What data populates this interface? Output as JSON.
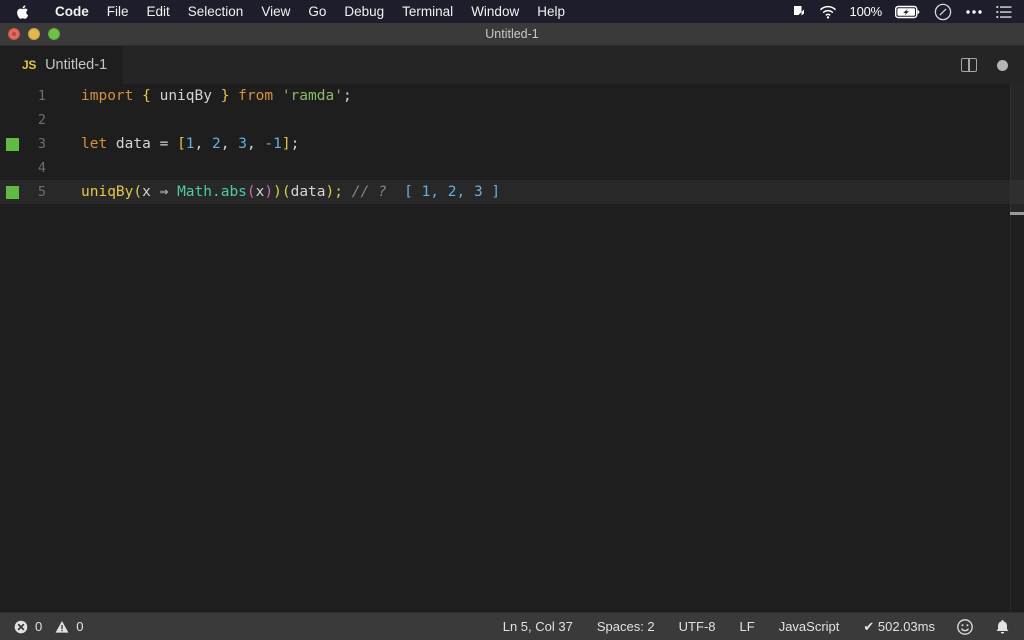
{
  "menubar": {
    "apple_icon": "apple-logo-icon",
    "items": [
      {
        "label": "Code",
        "bold": true
      },
      {
        "label": "File",
        "bold": false
      },
      {
        "label": "Edit",
        "bold": false
      },
      {
        "label": "Selection",
        "bold": false
      },
      {
        "label": "View",
        "bold": false
      },
      {
        "label": "Go",
        "bold": false
      },
      {
        "label": "Debug",
        "bold": false
      },
      {
        "label": "Terminal",
        "bold": false
      },
      {
        "label": "Window",
        "bold": false
      },
      {
        "label": "Help",
        "bold": false
      }
    ],
    "status_icons": [
      "dropbox-icon",
      "wifi-icon",
      "battery-icon",
      "siri-icon",
      "control-center-icon",
      "notification-center-icon"
    ],
    "battery_percent": "100%",
    "background_color": "#1d1d2b"
  },
  "window": {
    "title": "Untitled-1",
    "traffic_lights": [
      "close-button",
      "minimize-button",
      "zoom-button"
    ],
    "titlebar_color": "#3a3a3a"
  },
  "tabstrip": {
    "tab": {
      "file_type_badge": "JS",
      "label": "Untitled-1"
    },
    "actions": {
      "split_editor": "split-editor-icon",
      "unsaved_indicator": "unsaved-dot-icon"
    }
  },
  "editor": {
    "language": "JavaScript",
    "background_color": "#1e1e1e",
    "current_line": 5,
    "lines": [
      {
        "number": "1",
        "has_run_marker": false,
        "current": false,
        "tokens": [
          {
            "text": "import",
            "cls": "t-kw"
          },
          {
            "text": " ",
            "cls": "t-plain"
          },
          {
            "text": "{",
            "cls": "t-brace"
          },
          {
            "text": " uniqBy ",
            "cls": "t-plain"
          },
          {
            "text": "}",
            "cls": "t-brace"
          },
          {
            "text": " ",
            "cls": "t-plain"
          },
          {
            "text": "from",
            "cls": "t-kw"
          },
          {
            "text": " ",
            "cls": "t-plain"
          },
          {
            "text": "'ramda'",
            "cls": "t-string"
          },
          {
            "text": ";",
            "cls": "t-plain"
          }
        ]
      },
      {
        "number": "2",
        "has_run_marker": false,
        "current": false,
        "tokens": []
      },
      {
        "number": "3",
        "has_run_marker": true,
        "current": false,
        "tokens": [
          {
            "text": "let",
            "cls": "t-kw"
          },
          {
            "text": " data ",
            "cls": "t-plain"
          },
          {
            "text": "=",
            "cls": "t-plain"
          },
          {
            "text": " ",
            "cls": "t-plain"
          },
          {
            "text": "[",
            "cls": "t-brace"
          },
          {
            "text": "1",
            "cls": "t-num"
          },
          {
            "text": ", ",
            "cls": "t-plain"
          },
          {
            "text": "2",
            "cls": "t-num"
          },
          {
            "text": ", ",
            "cls": "t-plain"
          },
          {
            "text": "3",
            "cls": "t-num"
          },
          {
            "text": ", ",
            "cls": "t-plain"
          },
          {
            "text": "-1",
            "cls": "t-num"
          },
          {
            "text": "]",
            "cls": "t-brace"
          },
          {
            "text": ";",
            "cls": "t-plain"
          }
        ]
      },
      {
        "number": "4",
        "has_run_marker": false,
        "current": false,
        "tokens": []
      },
      {
        "number": "5",
        "has_run_marker": true,
        "current": true,
        "tokens": [
          {
            "text": "uniqBy",
            "cls": "t-fn"
          },
          {
            "text": "(",
            "cls": "t-paren-y"
          },
          {
            "text": "x",
            "cls": "t-plain"
          },
          {
            "text": " ⇒ ",
            "cls": "t-plain"
          },
          {
            "text": "Math",
            "cls": "t-class"
          },
          {
            "text": ".",
            "cls": "t-class"
          },
          {
            "text": "abs",
            "cls": "t-class"
          },
          {
            "text": "(",
            "cls": "t-paren-m"
          },
          {
            "text": "x",
            "cls": "t-plain"
          },
          {
            "text": ")",
            "cls": "t-paren-m"
          },
          {
            "text": ")",
            "cls": "t-paren-y"
          },
          {
            "text": "(",
            "cls": "t-paren-y"
          },
          {
            "text": "data",
            "cls": "t-plain"
          },
          {
            "text": ")",
            "cls": "t-paren-y"
          },
          {
            "text": ";",
            "cls": "t-brace"
          },
          {
            "text": " ",
            "cls": "t-plain"
          },
          {
            "text": "// ?",
            "cls": "t-comment"
          },
          {
            "text": "  ",
            "cls": "t-plain"
          },
          {
            "text": "[ 1, 2, 3 ]",
            "cls": "t-result"
          }
        ]
      }
    ],
    "run_marker_color": "#61ba46"
  },
  "statusbar": {
    "error_count": "0",
    "warning_count": "0",
    "error_icon": "error-circle-icon",
    "warning_icon": "warning-triangle-icon",
    "items": [
      {
        "label": "Ln 5, Col 37",
        "name": "cursor-position"
      },
      {
        "label": "Spaces: 2",
        "name": "indentation"
      },
      {
        "label": "UTF-8",
        "name": "encoding"
      },
      {
        "label": "LF",
        "name": "line-ending"
      },
      {
        "label": "JavaScript",
        "name": "language-mode"
      },
      {
        "label": "✔ 502.03ms",
        "name": "quokka-run-time"
      }
    ],
    "feedback_icon": "smiley-icon",
    "bell_icon": "bell-icon",
    "background_color": "#3a3a3a"
  }
}
